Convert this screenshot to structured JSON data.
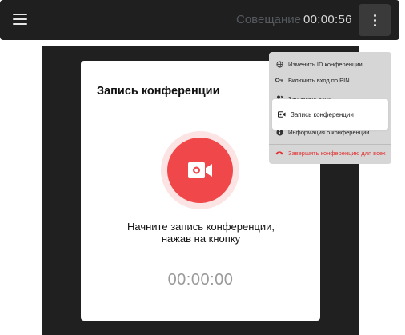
{
  "topbar": {
    "meeting_title": "Совещание",
    "timer": "00:00:56"
  },
  "dialog": {
    "title": "Запись конференции",
    "instruction": "Начните запись конференции, нажав на кнопку",
    "timer": "00:00:00"
  },
  "menu": {
    "items": [
      {
        "label": "Изменить ID конференции",
        "icon": "globe-icon"
      },
      {
        "label": "Включить вход по PIN",
        "icon": "key-icon"
      },
      {
        "label": "Запретить вход",
        "icon": "person-block-icon"
      },
      {
        "label": "Запись конференции",
        "icon": "video-camera-icon"
      },
      {
        "label": "Информация о конференции",
        "icon": "info-icon"
      }
    ],
    "end_for_all": {
      "label": "Завершить конференцию для всех",
      "icon": "hangup-icon"
    }
  },
  "colors": {
    "accent_red": "#f0484a",
    "danger_text": "#e03131",
    "topbar_bg": "#1f1f1f",
    "stage_bg": "#202020"
  }
}
